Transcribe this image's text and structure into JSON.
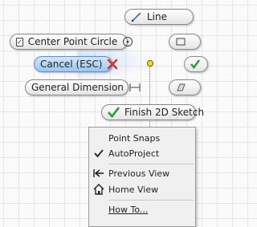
{
  "marking_menu": {
    "line_label": "Line",
    "center_point_circle_label": "Center Point Circle",
    "cancel_label": "Cancel (ESC)",
    "general_dimension_label": "General Dimension",
    "finish_sketch_label": "Finish 2D Sketch",
    "center_point_circle_checked": true
  },
  "context_menu": {
    "items": [
      {
        "label": "Point Snaps",
        "icon": "none"
      },
      {
        "label": "AutoProject",
        "icon": "checkmark-icon",
        "checked": true
      },
      {
        "label": "Previous View",
        "icon": "previous-view-icon"
      },
      {
        "label": "Home View",
        "icon": "home-icon"
      },
      {
        "label": "How To...",
        "icon": "none"
      }
    ]
  },
  "colors": {
    "cancel_x": "#d6322b",
    "finish_check": "#2a9a35",
    "active_pill": "#9cc5ee",
    "snap_point": "#ffe100"
  }
}
